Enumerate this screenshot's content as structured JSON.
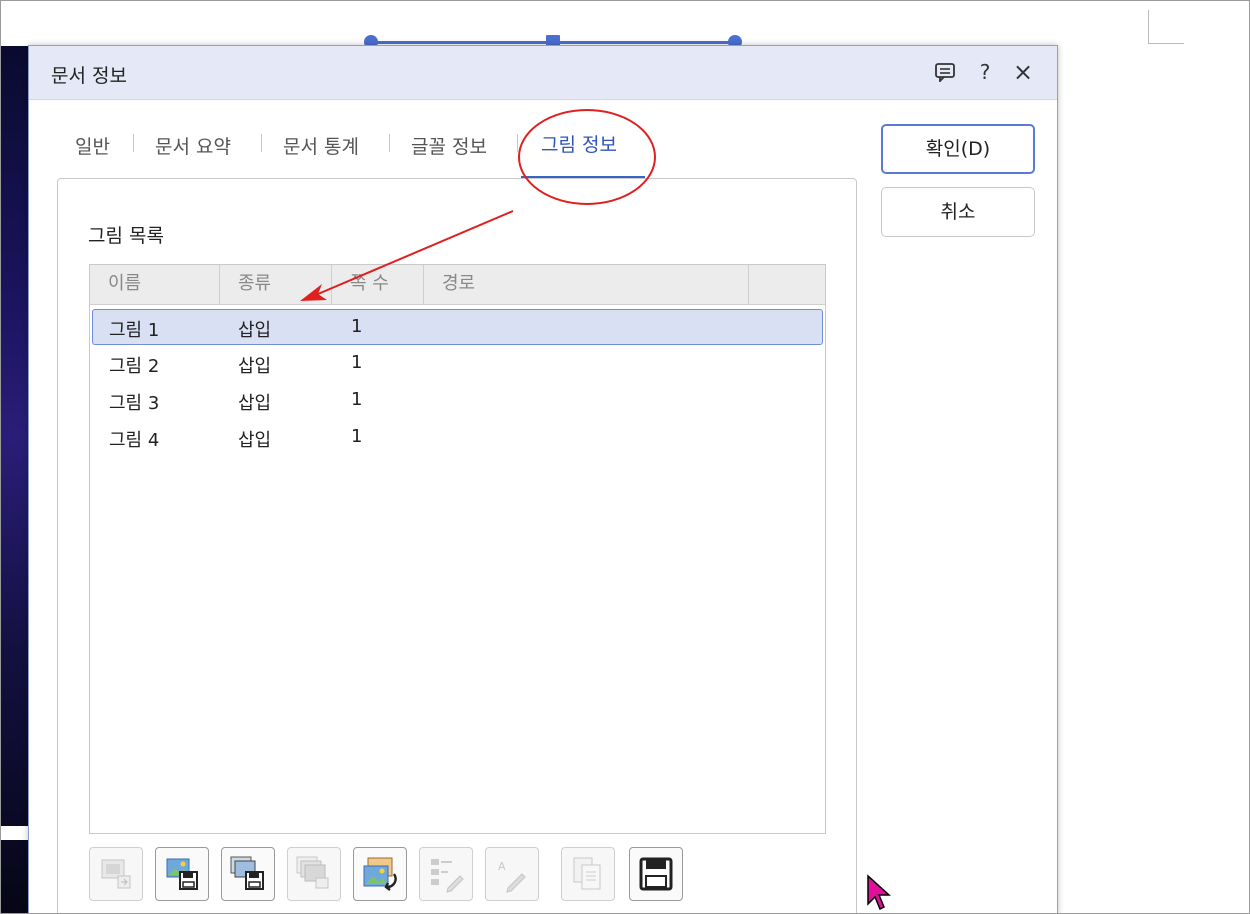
{
  "dialog": {
    "title": "문서 정보",
    "title_icons": [
      "comment-icon",
      "help-icon",
      "close-icon"
    ],
    "help_glyph": "?",
    "close_glyph": "×"
  },
  "tabs": [
    {
      "label": "일반",
      "active": false
    },
    {
      "label": "문서 요약",
      "active": false
    },
    {
      "label": "문서 통계",
      "active": false
    },
    {
      "label": "글꼴 정보",
      "active": false
    },
    {
      "label": "그림 정보",
      "active": true
    }
  ],
  "picture_list": {
    "section_label": "그림 목록",
    "columns": [
      "이름",
      "종류",
      "쪽 수",
      "경로",
      ""
    ],
    "rows": [
      {
        "name": "그림 1",
        "type": "삽입",
        "page": "1",
        "path": "",
        "selected": true
      },
      {
        "name": "그림 2",
        "type": "삽입",
        "page": "1",
        "path": "",
        "selected": false
      },
      {
        "name": "그림 3",
        "type": "삽입",
        "page": "1",
        "path": "",
        "selected": false
      },
      {
        "name": "그림 4",
        "type": "삽입",
        "page": "1",
        "path": "",
        "selected": false
      }
    ]
  },
  "toolbar": [
    {
      "icon": "insert-picture-icon",
      "enabled": false
    },
    {
      "icon": "save-picture-icon",
      "enabled": true
    },
    {
      "icon": "save-all-pictures-icon",
      "enabled": true
    },
    {
      "icon": "replace-all-pictures-icon",
      "enabled": false
    },
    {
      "icon": "change-picture-icon",
      "enabled": true
    },
    {
      "icon": "edit-list-icon",
      "enabled": false
    },
    {
      "icon": "rename-icon",
      "enabled": false
    },
    {
      "icon": "copy-icon",
      "enabled": false
    },
    {
      "icon": "save-icon",
      "enabled": true
    }
  ],
  "buttons": {
    "ok_label": "확인(D)",
    "cancel_label": "취소"
  },
  "colors": {
    "accent": "#3a63c7",
    "title_bar": "#e5e9f7",
    "selection": "#d9e0f3",
    "annotation": "#e02020"
  }
}
